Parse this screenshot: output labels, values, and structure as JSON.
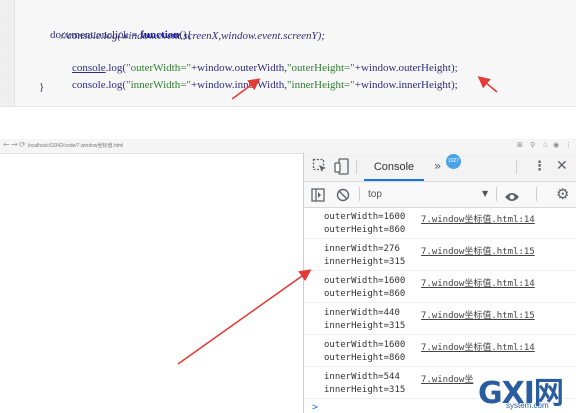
{
  "code": {
    "line1": {
      "obj": "document.",
      "prop": "onclick",
      "eq": " = ",
      "kw": "function",
      "tail": "(){"
    },
    "line2": "//console.log(window.event.screenX,window.event.screenY);",
    "line3": {
      "obj": "console",
      "call": ".log(",
      "s1": "\"outerWidth=\"",
      "p1": "+window.outerWidth,",
      "s2": "\"outerHeight=\"",
      "p2": "+window.outerHeight);"
    },
    "line4": {
      "obj": "console",
      "call": ".log(",
      "s1": "\"innerWidth=\"",
      "p1": "+window.innerWidth,",
      "s2": "\"innerHeight=\"",
      "p2": "+window.innerHeight);"
    },
    "line5": "}"
  },
  "browser": {
    "address": "localhost:63342/code/7.window坐标值.html"
  },
  "devtools": {
    "tab_label": "Console",
    "badge_count": "1027",
    "context": "top",
    "icons": {
      "inspect": "inspect-element-icon",
      "device": "device-toolbar-icon",
      "more_tabs": "more-tabs-icon",
      "menu": "kebab-menu-icon",
      "close": "close-icon",
      "sidebar": "sidebar-toggle-icon",
      "clear": "clear-console-icon",
      "eye": "live-expression-icon",
      "gear": "settings-gear-icon"
    },
    "logs": [
      {
        "l1": "outerWidth=1600",
        "l2": "outerHeight=860",
        "src": "7.window坐标值.html:14"
      },
      {
        "l1": "innerWidth=276",
        "l2": "innerHeight=315",
        "src": "7.window坐标值.html:15"
      },
      {
        "l1": "outerWidth=1600",
        "l2": "outerHeight=860",
        "src": "7.window坐标值.html:14"
      },
      {
        "l1": "innerWidth=440",
        "l2": "innerHeight=315",
        "src": "7.window坐标值.html:15"
      },
      {
        "l1": "outerWidth=1600",
        "l2": "outerHeight=860",
        "src": "7.window坐标值.html:14"
      },
      {
        "l1": "innerWidth=544",
        "l2": "innerHeight=315",
        "src": "7.window坐"
      }
    ],
    "prompt": ">"
  },
  "watermark": {
    "big": "GXI网",
    "small": "system.com"
  },
  "colors": {
    "accent": "#1a73e8",
    "arrow": "#e53935",
    "badge": "#4aa3e8"
  }
}
